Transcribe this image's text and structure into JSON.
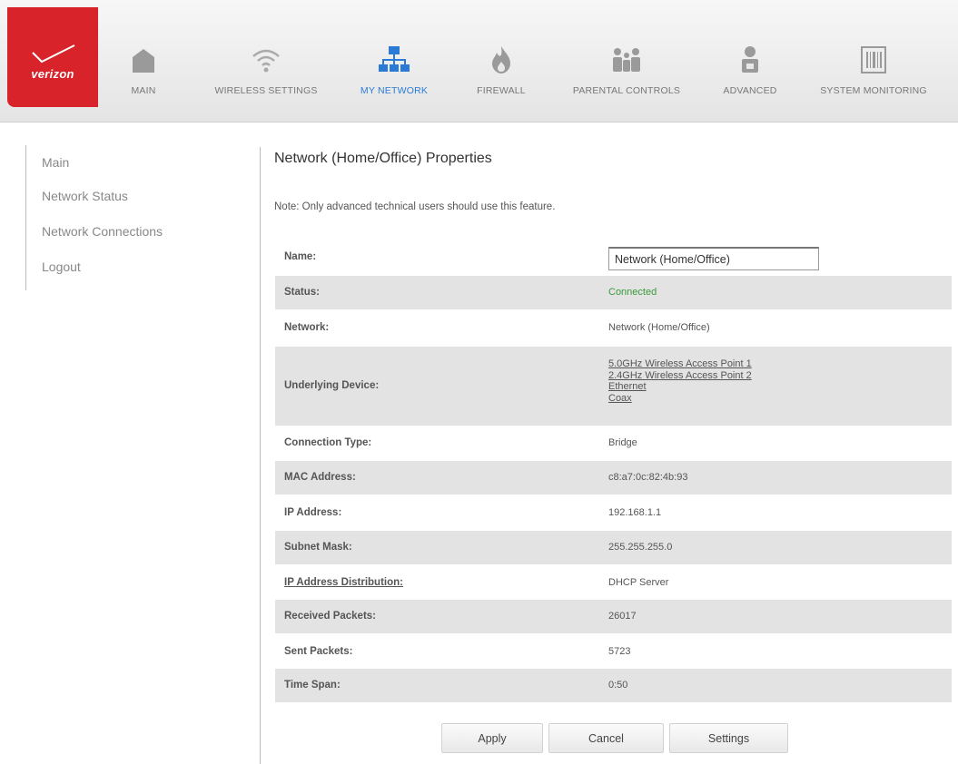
{
  "brand": {
    "logo_text": "verizon",
    "accent_color": "#d8232a"
  },
  "nav": {
    "active": "MY NETWORK",
    "items": [
      {
        "label": "MAIN",
        "icon": "home-icon"
      },
      {
        "label": "WIRELESS SETTINGS",
        "icon": "wifi-icon"
      },
      {
        "label": "MY NETWORK",
        "icon": "network-icon"
      },
      {
        "label": "FIREWALL",
        "icon": "flame-icon"
      },
      {
        "label": "PARENTAL CONTROLS",
        "icon": "family-icon"
      },
      {
        "label": "ADVANCED",
        "icon": "advanced-user-icon"
      },
      {
        "label": "SYSTEM MONITORING",
        "icon": "barcode-icon"
      }
    ]
  },
  "sidebar": {
    "items": [
      {
        "label": "Main"
      },
      {
        "label": "Network Status"
      },
      {
        "label": "Network Connections"
      },
      {
        "label": "Logout"
      }
    ]
  },
  "content": {
    "title": "Network (Home/Office) Properties",
    "note": "Note: Only advanced technical users should use this feature.",
    "rows": {
      "name": {
        "label": "Name:",
        "value": "Network (Home/Office)"
      },
      "status": {
        "label": "Status:",
        "value": "Connected",
        "value_color": "#3a9a3a"
      },
      "network": {
        "label": "Network:",
        "value": "Network (Home/Office)"
      },
      "underlying": {
        "label": "Underlying Device:",
        "links": [
          "5.0GHz Wireless Access Point 1",
          "2.4GHz Wireless Access Point 2",
          "Ethernet",
          "Coax"
        ]
      },
      "connection_type": {
        "label": "Connection Type:",
        "value": "Bridge"
      },
      "mac": {
        "label": "MAC Address:",
        "value": "c8:a7:0c:82:4b:93"
      },
      "ip": {
        "label": "IP Address:",
        "value": "192.168.1.1"
      },
      "subnet": {
        "label": "Subnet Mask:",
        "value": "255.255.255.0"
      },
      "ip_dist": {
        "label": "IP Address Distribution:",
        "value": "DHCP Server"
      },
      "received": {
        "label": "Received Packets:",
        "value": "26017"
      },
      "sent": {
        "label": "Sent Packets:",
        "value": "5723"
      },
      "timespan": {
        "label": "Time Span:",
        "value": "0:50"
      }
    }
  },
  "buttons": {
    "apply": "Apply",
    "cancel": "Cancel",
    "settings": "Settings"
  }
}
